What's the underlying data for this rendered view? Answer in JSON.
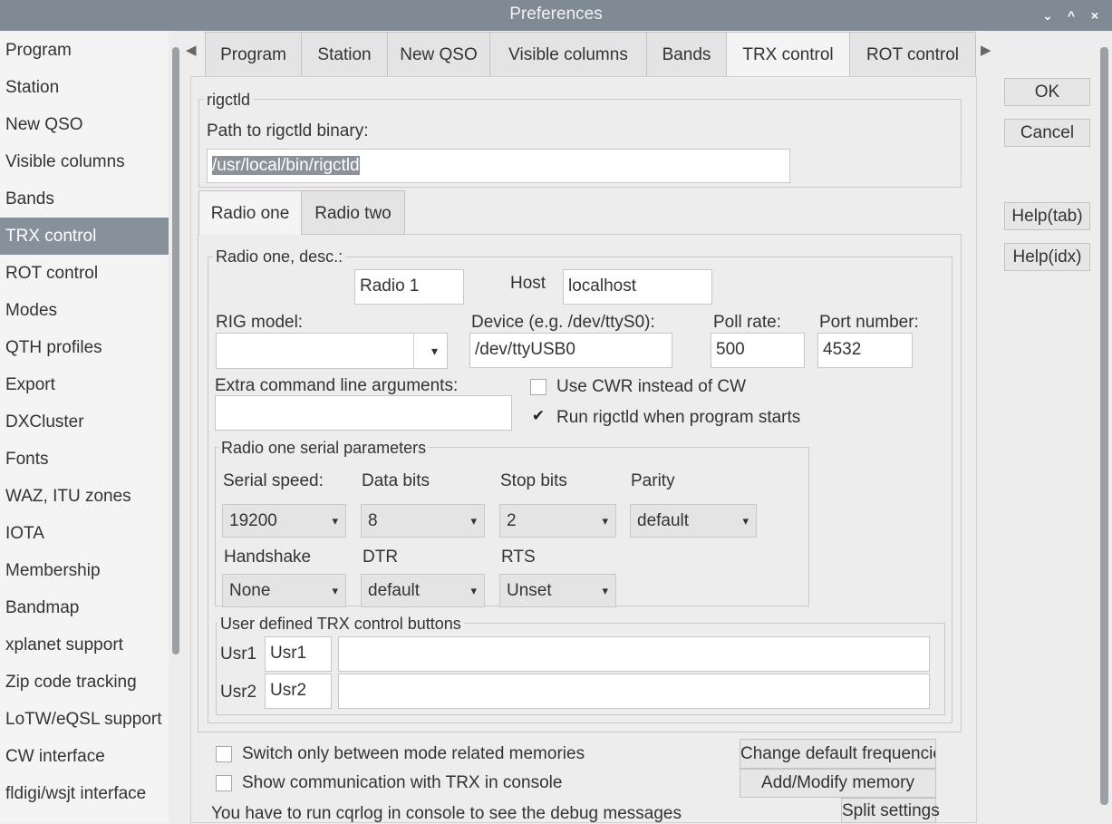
{
  "window": {
    "title": "Preferences",
    "controls": [
      "⌄",
      "^",
      "×"
    ]
  },
  "sidebar": {
    "items": [
      "Program",
      "Station",
      "New QSO",
      "Visible columns",
      "Bands",
      "TRX control",
      "ROT control",
      "Modes",
      "QTH profiles",
      "Export",
      "DXCluster",
      "Fonts",
      "WAZ, ITU zones",
      "IOTA",
      "Membership",
      "Bandmap",
      "xplanet support",
      "Zip code tracking",
      "LoTW/eQSL support",
      "CW interface",
      "fldigi/wsjt interface"
    ],
    "selected": "TRX control"
  },
  "tabs": {
    "items": [
      "Program",
      "Station",
      "New QSO",
      "Visible columns",
      "Bands",
      "TRX control",
      "ROT control"
    ],
    "selected": "TRX control",
    "left_arrow": "◀",
    "right_arrow": "▶"
  },
  "rigctld": {
    "legend": "rigctld",
    "path_label": "Path to rigctld binary:",
    "path_value": "/usr/local/bin/rigctld"
  },
  "radio_tabs": {
    "one": "Radio one",
    "two": "Radio two"
  },
  "radio_one": {
    "desc_legend": "Radio one, desc.:",
    "desc_value": "Radio 1",
    "host_label": "Host",
    "host_value": "localhost",
    "rig_model_label": "RIG model:",
    "rig_model_value": "",
    "device_label": "Device (e.g. /dev/ttyS0):",
    "device_value": "/dev/ttyUSB0",
    "poll_label": "Poll rate:",
    "poll_value": "500",
    "port_label": "Port number:",
    "port_value": "4532",
    "extra_label": "Extra command line arguments:",
    "extra_value": "",
    "cwr_label": "Use CWR instead of CW",
    "cwr_checked": "",
    "run_label": "Run rigctld when program starts",
    "run_checked": "✔"
  },
  "serial": {
    "legend": "Radio one serial parameters",
    "speed_label": "Serial speed:",
    "speed_value": "19200",
    "databits_label": "Data bits",
    "databits_value": "8",
    "stopbits_label": "Stop bits",
    "stopbits_value": "2",
    "parity_label": "Parity",
    "parity_value": "default",
    "handshake_label": "Handshake",
    "handshake_value": "None",
    "dtr_label": "DTR",
    "dtr_value": "default",
    "rts_label": "RTS",
    "rts_value": "Unset"
  },
  "user_buttons": {
    "legend": "User defined TRX control buttons",
    "rows": [
      {
        "label": "Usr1",
        "name": "Usr1",
        "command": ""
      },
      {
        "label": "Usr2",
        "name": "Usr2",
        "command": ""
      }
    ]
  },
  "bottom": {
    "switch_label": "Switch only between mode related memories",
    "show_label": "Show communication with TRX in console",
    "note": "You have to run cqrlog in console to see the debug messages",
    "change_freq_btn": "Change default frequencies",
    "add_memory_btn": "Add/Modify memory",
    "split_btn": "Split settings"
  },
  "buttons": {
    "ok": "OK",
    "cancel": "Cancel",
    "help_tab": "Help(tab)",
    "help_idx": "Help(idx)"
  },
  "combo_arrow": "▾"
}
